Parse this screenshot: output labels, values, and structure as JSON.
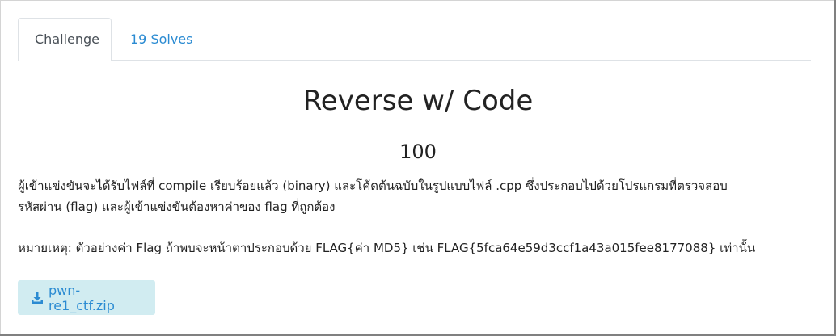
{
  "tabs": [
    {
      "label": "Challenge",
      "active": true
    },
    {
      "label": "19 Solves",
      "active": false
    }
  ],
  "challenge": {
    "name": "Reverse w/ Code",
    "value": "100",
    "description_line1": "ผู้เข้าแข่งขันจะได้รับไฟล์ที่ compile เรียบร้อยแล้ว (binary) และโค้ดต้นฉบับในรูปแบบไฟล์ .cpp ซึ่งประกอบไปด้วยโปรแกรมที่ตรวจสอบ",
    "description_line2": "รหัสผ่าน (flag) และผู้เข้าแข่งขันต้องหาค่าของ flag ที่ถูกต้อง",
    "note": "หมายเหตุ: ตัวอย่างค่า Flag ถ้าพบจะหน้าตาประกอบด้วย FLAG{ค่า MD5} เช่น FLAG{5fca64e59d3ccf1a43a015fee8177088} เท่านั้น"
  },
  "files": [
    {
      "name": "pwn-re1_ctf.zip",
      "icon": "download-icon"
    }
  ],
  "colors": {
    "link": "#2b8bd2",
    "download_bg": "#d1ecf1",
    "tab_border": "#dee2e6"
  }
}
